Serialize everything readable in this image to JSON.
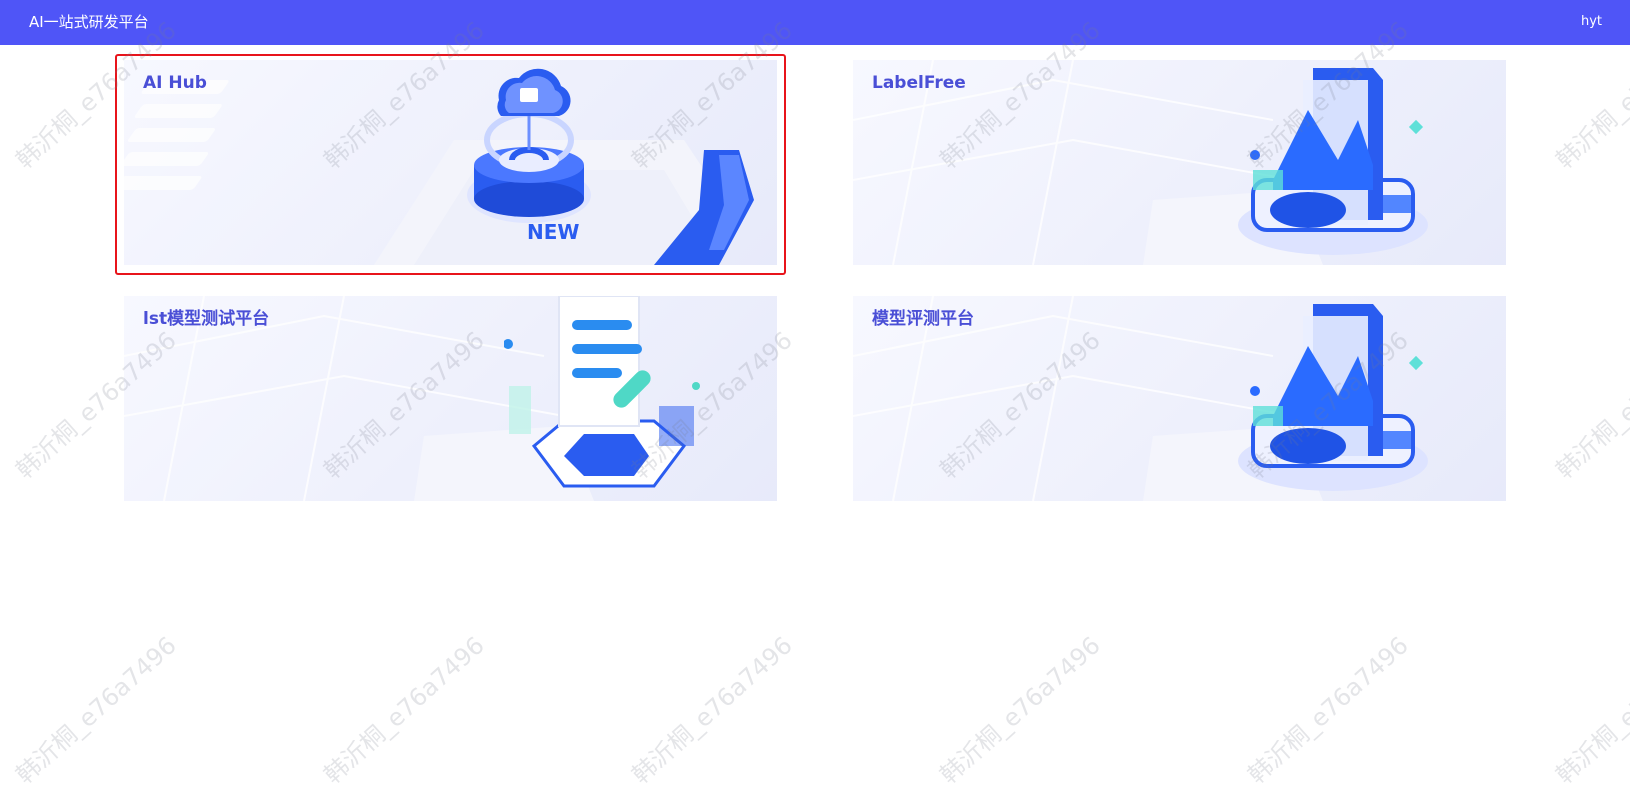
{
  "header": {
    "app_title": "AI一站式研发平台",
    "user_name": "hyt"
  },
  "cards": [
    {
      "title": "AI Hub",
      "badge": "NEW"
    },
    {
      "title": "LabelFree"
    },
    {
      "title": "lst模型测试平台"
    },
    {
      "title": "模型评测平台"
    }
  ],
  "watermark": {
    "text": "韩沂桐_e76a7496"
  },
  "colors": {
    "header_bg": "#4f55f7",
    "card_title": "#4a4fd6",
    "selection_border": "#e8141b",
    "illustration_blue": "#2a5cf0"
  },
  "icons": [
    "cloud-icon",
    "chart-icon",
    "document-icon"
  ]
}
